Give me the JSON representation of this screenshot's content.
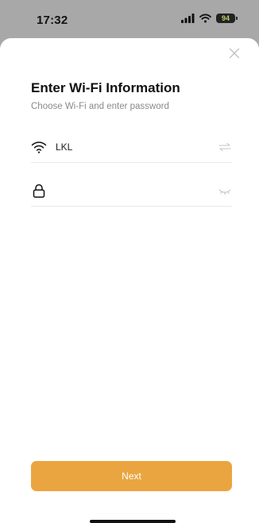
{
  "status_bar": {
    "time": "17:32",
    "battery": "94",
    "icons": [
      "cellular-signal-icon",
      "wifi-icon",
      "battery-icon"
    ]
  },
  "sheet": {
    "close_icon": "close-icon",
    "title": "Enter Wi-Fi Information",
    "subtitle": "Choose Wi-Fi and enter password",
    "ssid_field": {
      "icon": "wifi-icon",
      "value": "LKL",
      "action_icon": "switch-network-icon"
    },
    "password_field": {
      "icon": "lock-icon",
      "value": "",
      "placeholder": "",
      "action_icon": "eye-closed-icon"
    },
    "next_label": "Next"
  },
  "colors": {
    "accent": "#eaa540",
    "subtitle": "#8a8a8a",
    "divider": "#e8e8e8",
    "backdrop": "#a8a8a8"
  }
}
